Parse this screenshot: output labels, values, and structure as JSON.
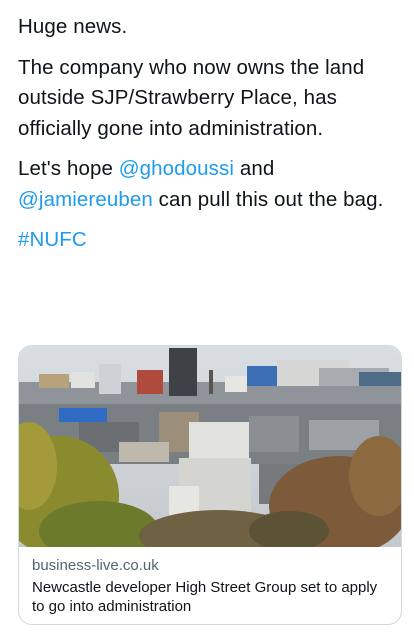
{
  "tweet": {
    "line1": "Huge news.",
    "para2": "The company who now owns the land outside SJP/Strawberry Place, has officially gone into administration.",
    "para3_prefix": "Let's hope ",
    "mention1": "@ghodoussi",
    "para3_mid": " and",
    "mention2": "@jamiereuben",
    "para3_suffix": " can pull this out the bag.",
    "hashtag": "#NUFC"
  },
  "link_card": {
    "domain": "business-live.co.uk",
    "title": "Newcastle developer High Street Group set to apply to go into administration"
  },
  "colors": {
    "text": "#0f1419",
    "link": "#1d9bf0",
    "secondary": "#536471",
    "border": "#cfd9de"
  }
}
